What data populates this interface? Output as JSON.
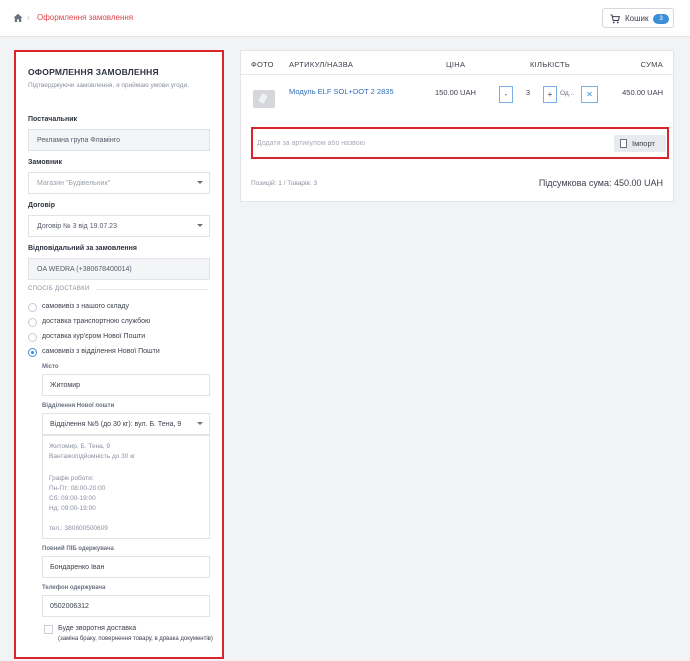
{
  "breadcrumb": {
    "home_icon": "home-icon",
    "current": "Оформлення замовлення"
  },
  "cart": {
    "label": "Кошик",
    "count": "3",
    "icon": "cart-icon"
  },
  "order_form": {
    "title": "ОФОРМЛЕННЯ ЗАМОВЛЕННЯ",
    "subtitle": "Підтверджуючи замовлення, я приймаю умови угоди.",
    "supplier_label": "Постачальник",
    "supplier_value": "Рекламна група Фламінго",
    "customer_label": "Замовник",
    "customer_value": "Магазин \"Будівельник\"",
    "contract_label": "Договір",
    "contract_value": "Договір № 3 від 19.07.23",
    "responsible_label": "Відповідальний за замовлення",
    "responsible_value": "OA WEDRA (+380678400014)",
    "delivery_section": "СПОСІБ ДОСТАВКИ",
    "delivery_options": [
      {
        "label": "самовивіз з нашого складу",
        "selected": false
      },
      {
        "label": "доставка транспортною службою",
        "selected": false
      },
      {
        "label": "доставка кур'єром Нової Пошти",
        "selected": false
      },
      {
        "label": "самовивіз з відділення Нової Пошти",
        "selected": true
      }
    ],
    "city_label": "Місто",
    "city_value": "Житомир",
    "branch_label": "Відділення Нової пошти",
    "branch_value": "Відділення №5 (до 30 кг): вул. Б. Тена, 9",
    "branch_info": {
      "address": "Житомир, Б. Тена, 9",
      "capacity": "Вантажопідйомність до 30 кг",
      "schedule_title": "Графік роботи:",
      "schedule": [
        "Пн-Пт: 08:00-20:00",
        "Сб: 09:00-19:00",
        "Нд: 09:00-19:00"
      ],
      "phone": "тел.: 380800500609"
    },
    "recipient_label": "Повний ПІБ одержувача",
    "recipient_value": "Бондаренко Іван",
    "phone_label": "Телефон одержувача",
    "phone_value": "0502006312",
    "return_label": "Буде зворотня доставка",
    "return_note": "(заміна браку, повернення товару, в дрвака документів)"
  },
  "cart_table": {
    "headers": {
      "photo": "ФОТО",
      "article": "АРТИКУЛ/НАЗВА",
      "price": "ЦІНА",
      "qty": "КІЛЬКІСТЬ",
      "sum": "СУМА"
    },
    "rows": [
      {
        "name": "Модуль ELF SOL+DOT 2 2835",
        "price": "150.00 UAH",
        "qty": "3",
        "unit": "Од...",
        "sum": "450.00 UAH"
      }
    ],
    "add_placeholder": "Додати за артикулом або назвою",
    "import_label": "Імпорт",
    "footer_counts": "Позицій: 1  /  Товарів: 3",
    "total": "Підсумкова сума: 450.00 UAH"
  },
  "colors": {
    "accent": "#3c8ed8",
    "highlight": "#d9262c",
    "link": "#2f6fb8",
    "breadcrumb": "#e0454a"
  }
}
